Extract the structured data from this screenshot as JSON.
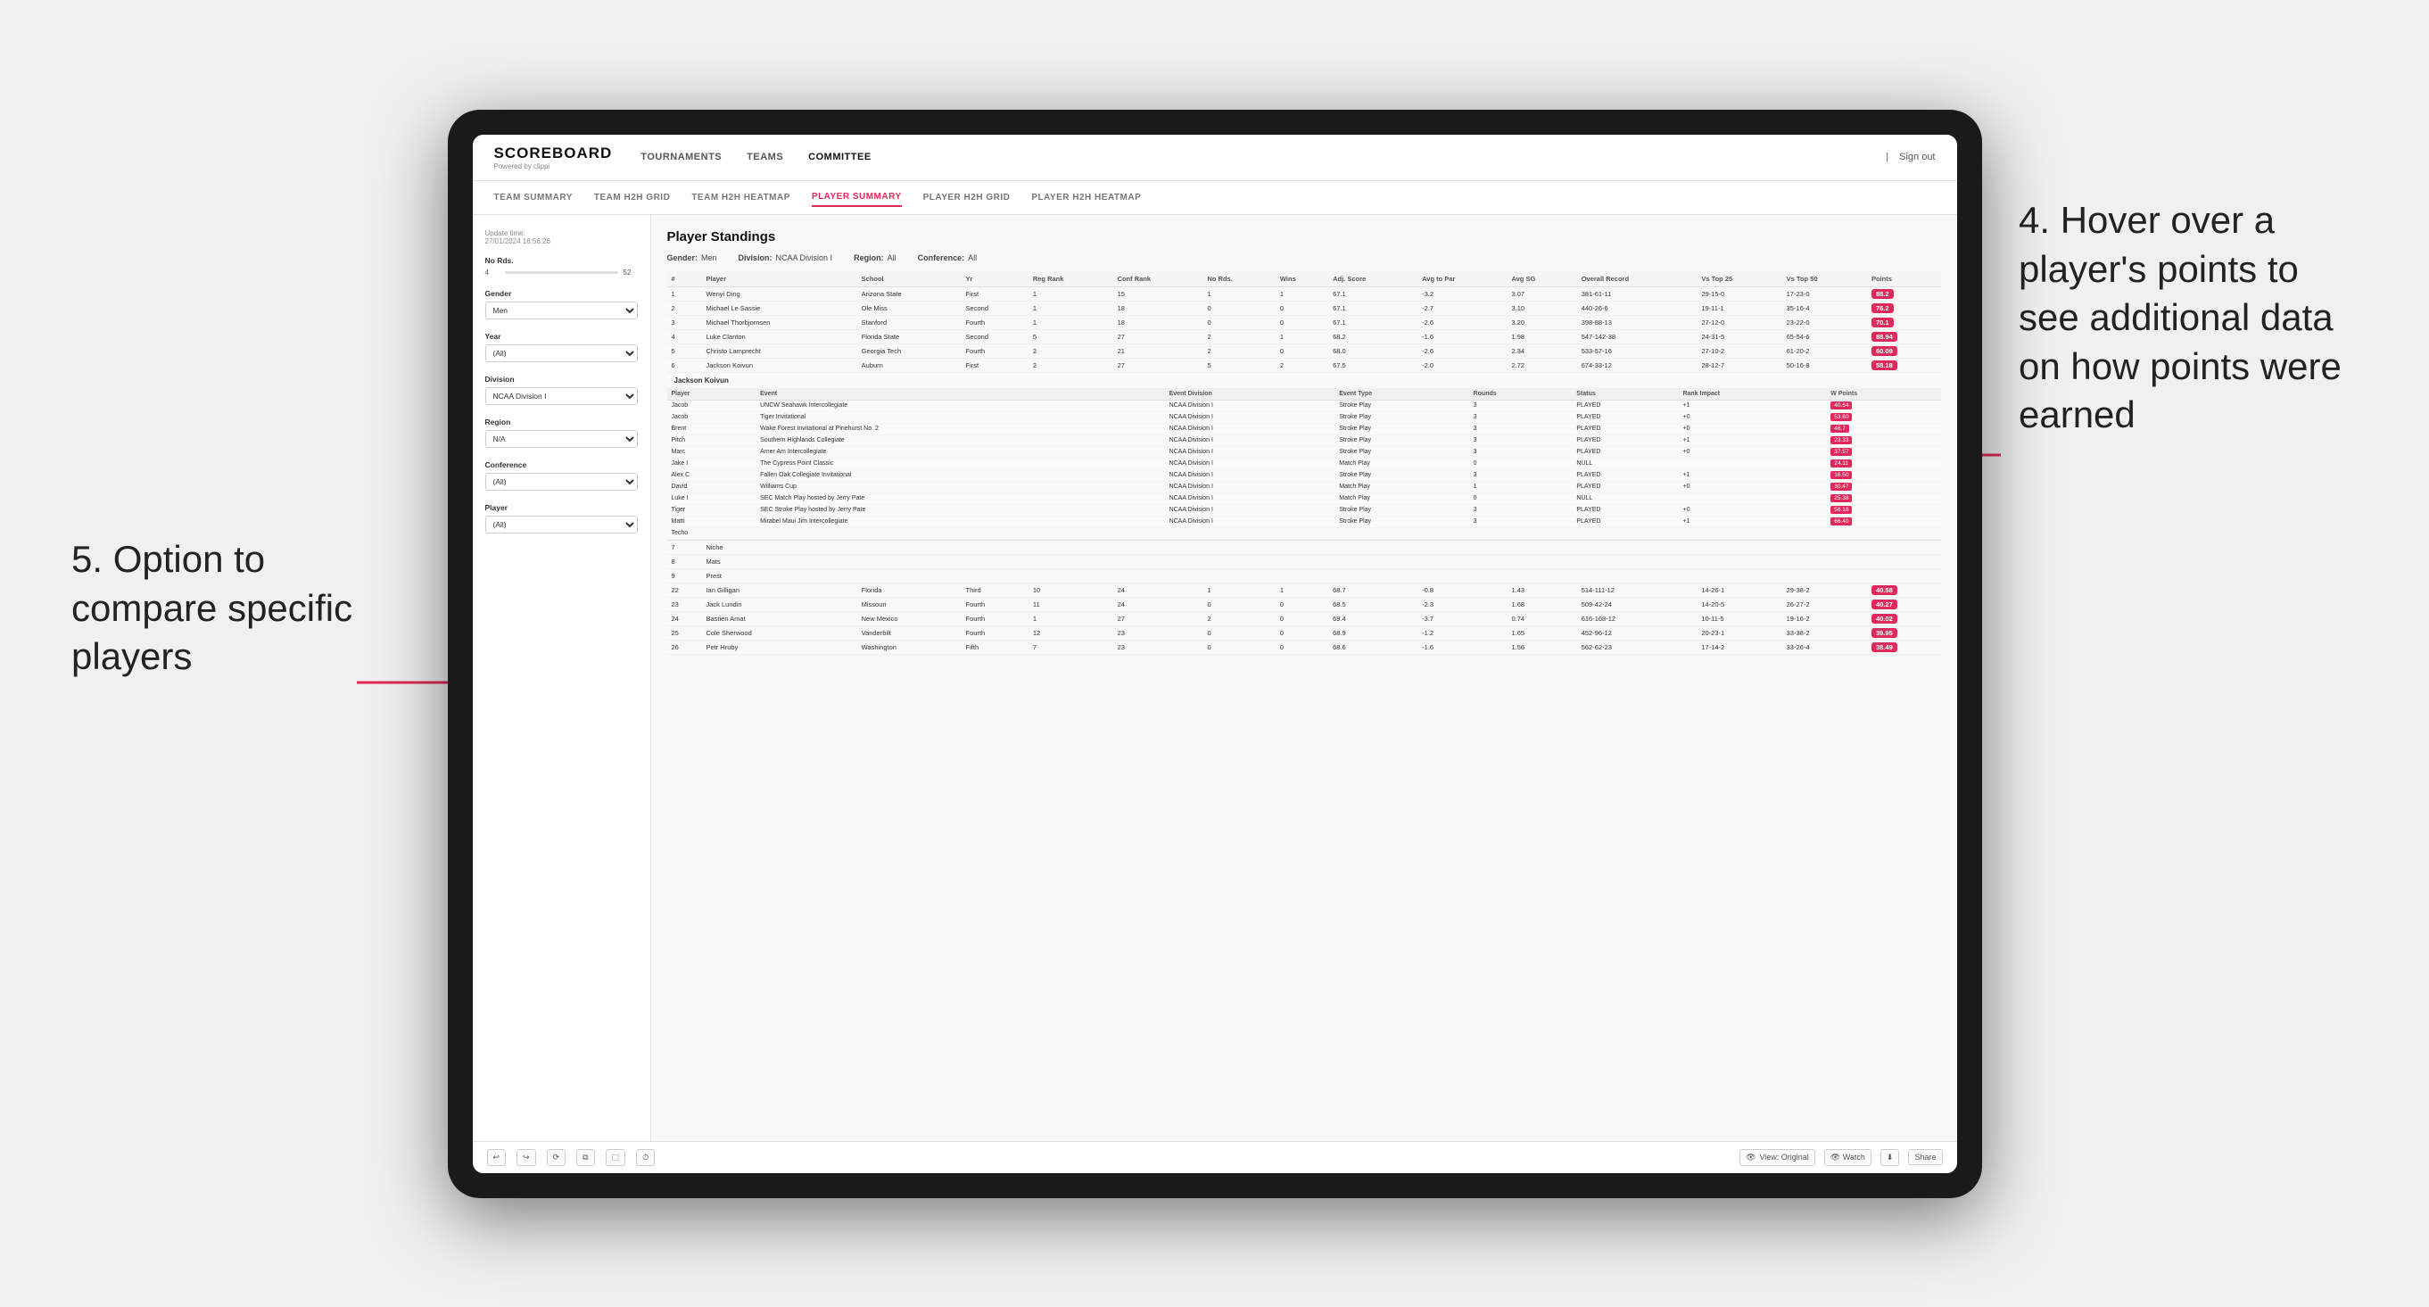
{
  "app": {
    "logo": "SCOREBOARD",
    "logo_sub": "Powered by clippi",
    "sign_out": "Sign out"
  },
  "nav": {
    "items": [
      "TOURNAMENTS",
      "TEAMS",
      "COMMITTEE"
    ],
    "active": "COMMITTEE"
  },
  "sub_nav": {
    "items": [
      "TEAM SUMMARY",
      "TEAM H2H GRID",
      "TEAM H2H HEATMAP",
      "PLAYER SUMMARY",
      "PLAYER H2H GRID",
      "PLAYER H2H HEATMAP"
    ],
    "active": "PLAYER SUMMARY"
  },
  "sidebar": {
    "update_time_label": "Update time:",
    "update_time_value": "27/01/2024 16:56:26",
    "no_rds_label": "No Rds.",
    "no_rds_min": "4",
    "no_rds_max": "52",
    "gender_label": "Gender",
    "gender_value": "Men",
    "year_label": "Year",
    "year_value": "(All)",
    "division_label": "Division",
    "division_value": "NCAA Division I",
    "region_label": "Region",
    "region_value": "N/A",
    "conference_label": "Conference",
    "conference_value": "(All)",
    "player_label": "Player",
    "player_value": "(All)"
  },
  "panel": {
    "title": "Player Standings",
    "gender_label": "Gender:",
    "gender_value": "Men",
    "division_label": "Division:",
    "division_value": "NCAA Division I",
    "region_label": "Region:",
    "region_value": "All",
    "conference_label": "Conference:",
    "conference_value": "All"
  },
  "table": {
    "headers": [
      "#",
      "Player",
      "School",
      "Yr",
      "Reg Rank",
      "Conf Rank",
      "No Rds.",
      "Wins",
      "Adj. Score",
      "Avg to Par",
      "Avg SG",
      "Overall Record",
      "Vs Top 25",
      "Vs Top 50",
      "Points"
    ],
    "rows": [
      {
        "num": "1",
        "player": "Wenyi Ding",
        "school": "Arizona State",
        "yr": "First",
        "reg_rank": "1",
        "conf_rank": "15",
        "no_rds": "1",
        "wins": "1",
        "adj_score": "67.1",
        "to_par": "-3.2",
        "avg_sg": "3.07",
        "overall": "381-61-11",
        "vs_top25": "29-15-0",
        "vs_top50": "17-23-0",
        "points": "88.2"
      },
      {
        "num": "2",
        "player": "Michael Le Sassie",
        "school": "Ole Miss",
        "yr": "Second",
        "reg_rank": "1",
        "conf_rank": "18",
        "no_rds": "0",
        "wins": "0",
        "adj_score": "67.1",
        "to_par": "-2.7",
        "avg_sg": "3.10",
        "overall": "440-26-6",
        "vs_top25": "19-11-1",
        "vs_top50": "35-16-4",
        "points": "76.2"
      },
      {
        "num": "3",
        "player": "Michael Thorbjornsen",
        "school": "Stanford",
        "yr": "Fourth",
        "reg_rank": "1",
        "conf_rank": "18",
        "no_rds": "0",
        "wins": "0",
        "adj_score": "67.1",
        "to_par": "-2.6",
        "avg_sg": "3.20",
        "overall": "398-88-13",
        "vs_top25": "27-12-0",
        "vs_top50": "23-22-0",
        "points": "70.1"
      },
      {
        "num": "4",
        "player": "Luke Clanton",
        "school": "Florida State",
        "yr": "Second",
        "reg_rank": "5",
        "conf_rank": "27",
        "no_rds": "2",
        "wins": "1",
        "adj_score": "68.2",
        "to_par": "-1.6",
        "avg_sg": "1.98",
        "overall": "547-142-38",
        "vs_top25": "24-31-5",
        "vs_top50": "65-54-6",
        "points": "88.94"
      },
      {
        "num": "5",
        "player": "Christo Lamprecht",
        "school": "Georgia Tech",
        "yr": "Fourth",
        "reg_rank": "2",
        "conf_rank": "21",
        "no_rds": "2",
        "wins": "0",
        "adj_score": "68.0",
        "to_par": "-2.6",
        "avg_sg": "2.34",
        "overall": "533-57-16",
        "vs_top25": "27-10-2",
        "vs_top50": "61-20-2",
        "points": "60.09"
      },
      {
        "num": "6",
        "player": "Jackson Koivun",
        "school": "Auburn",
        "yr": "First",
        "reg_rank": "2",
        "conf_rank": "27",
        "no_rds": "5",
        "wins": "2",
        "adj_score": "67.5",
        "to_par": "-2.0",
        "avg_sg": "2.72",
        "overall": "674-33-12",
        "vs_top25": "28-12-7",
        "vs_top50": "50-16-8",
        "points": "58.18"
      },
      {
        "num": "7",
        "player": "Niche",
        "school": "",
        "yr": "",
        "reg_rank": "",
        "conf_rank": "",
        "no_rds": "",
        "wins": "",
        "adj_score": "",
        "to_par": "",
        "avg_sg": "",
        "overall": "",
        "vs_top25": "",
        "vs_top50": "",
        "points": ""
      },
      {
        "num": "8",
        "player": "Mats",
        "school": "",
        "yr": "",
        "reg_rank": "",
        "conf_rank": "",
        "no_rds": "",
        "wins": "",
        "adj_score": "",
        "to_par": "",
        "avg_sg": "",
        "overall": "",
        "vs_top25": "",
        "vs_top50": "",
        "points": ""
      },
      {
        "num": "9",
        "player": "Prest",
        "school": "",
        "yr": "",
        "reg_rank": "",
        "conf_rank": "",
        "no_rds": "",
        "wins": "",
        "adj_score": "",
        "to_par": "",
        "avg_sg": "",
        "overall": "",
        "vs_top25": "",
        "vs_top50": "",
        "points": ""
      }
    ]
  },
  "tooltip": {
    "player_name": "Jackson Koivun",
    "headers": [
      "Player",
      "Event",
      "Event Division",
      "Event Type",
      "Rounds",
      "Status",
      "Rank Impact",
      "W Points"
    ],
    "rows": [
      {
        "player": "Jacob",
        "event": "UNCW Seahawk Intercollegiate",
        "division": "NCAA Division I",
        "type": "Stroke Play",
        "rounds": "3",
        "status": "PLAYED",
        "impact": "+1",
        "w_points": "40.64"
      },
      {
        "player": "Jacob",
        "event": "Tiger Invitational",
        "division": "NCAA Division I",
        "type": "Stroke Play",
        "rounds": "3",
        "status": "PLAYED",
        "impact": "+0",
        "w_points": "53.60"
      },
      {
        "player": "Brent",
        "event": "Wake Forest Invitational at Pinehurst No. 2",
        "division": "NCAA Division I",
        "type": "Stroke Play",
        "rounds": "3",
        "status": "PLAYED",
        "impact": "+0",
        "w_points": "46.7"
      },
      {
        "player": "Pitch",
        "event": "Southern Highlands Collegiate",
        "division": "NCAA Division I",
        "type": "Stroke Play",
        "rounds": "3",
        "status": "PLAYED",
        "impact": "+1",
        "w_points": "23.33"
      },
      {
        "player": "Marc",
        "event": "Amer Am Intercollegiate",
        "division": "NCAA Division I",
        "type": "Stroke Play",
        "rounds": "3",
        "status": "PLAYED",
        "impact": "+0",
        "w_points": "37.57"
      },
      {
        "player": "Jake I",
        "event": "The Cypress Point Classic",
        "division": "NCAA Division I",
        "type": "Match Play",
        "rounds": "0",
        "status": "NULL",
        "impact": "",
        "w_points": "24.11"
      },
      {
        "player": "Alex C",
        "event": "Fallen Oak Collegiate Invitational",
        "division": "NCAA Division I",
        "type": "Stroke Play",
        "rounds": "3",
        "status": "PLAYED",
        "impact": "+1",
        "w_points": "16.50"
      },
      {
        "player": "David",
        "event": "Williams Cup",
        "division": "NCAA Division I",
        "type": "Match Play",
        "rounds": "1",
        "status": "PLAYED",
        "impact": "+0",
        "w_points": "30.47"
      },
      {
        "player": "Luke I",
        "event": "SEC Match Play hosted by Jerry Pate",
        "division": "NCAA Division I",
        "type": "Match Play",
        "rounds": "0",
        "status": "NULL",
        "impact": "",
        "w_points": "25.38"
      },
      {
        "player": "Tiger",
        "event": "SEC Stroke Play hosted by Jerry Pate",
        "division": "NCAA Division I",
        "type": "Stroke Play",
        "rounds": "3",
        "status": "PLAYED",
        "impact": "+0",
        "w_points": "56.18"
      },
      {
        "player": "Matti",
        "event": "Mirabel Maui Jim Intercollegiate",
        "division": "NCAA Division I",
        "type": "Stroke Play",
        "rounds": "3",
        "status": "PLAYED",
        "impact": "+1",
        "w_points": "66.40"
      },
      {
        "player": "Techo",
        "event": "",
        "division": "",
        "type": "",
        "rounds": "",
        "status": "",
        "impact": "",
        "w_points": ""
      }
    ]
  },
  "extra_rows": [
    {
      "num": "22",
      "player": "Ian Gilligan",
      "school": "Florida",
      "yr": "Third",
      "reg_rank": "10",
      "conf_rank": "24",
      "no_rds": "1",
      "wins": "1",
      "adj_score": "68.7",
      "to_par": "-0.8",
      "avg_sg": "1.43",
      "overall": "514-111-12",
      "vs_top25": "14-26-1",
      "vs_top50": "29-38-2",
      "points": "40.58"
    },
    {
      "num": "23",
      "player": "Jack Lundin",
      "school": "Missouri",
      "yr": "Fourth",
      "reg_rank": "11",
      "conf_rank": "24",
      "no_rds": "0",
      "wins": "0",
      "adj_score": "68.5",
      "to_par": "-2.3",
      "avg_sg": "1.68",
      "overall": "509-42-24",
      "vs_top25": "14-20-5",
      "vs_top50": "26-27-2",
      "points": "40.27"
    },
    {
      "num": "24",
      "player": "Bastien Amat",
      "school": "New Mexico",
      "yr": "Fourth",
      "reg_rank": "1",
      "conf_rank": "27",
      "no_rds": "2",
      "wins": "0",
      "adj_score": "69.4",
      "to_par": "-3.7",
      "avg_sg": "0.74",
      "overall": "616-168-12",
      "vs_top25": "10-11-5",
      "vs_top50": "19-16-2",
      "points": "40.02"
    },
    {
      "num": "25",
      "player": "Cole Sherwood",
      "school": "Vanderbilt",
      "yr": "Fourth",
      "reg_rank": "12",
      "conf_rank": "23",
      "no_rds": "0",
      "wins": "0",
      "adj_score": "68.9",
      "to_par": "-1.2",
      "avg_sg": "1.65",
      "overall": "452-96-12",
      "vs_top25": "20-23-1",
      "vs_top50": "33-38-2",
      "points": "39.95"
    },
    {
      "num": "26",
      "player": "Petr Hruby",
      "school": "Washington",
      "yr": "Fifth",
      "reg_rank": "7",
      "conf_rank": "23",
      "no_rds": "0",
      "wins": "0",
      "adj_score": "68.6",
      "to_par": "-1.6",
      "avg_sg": "1.56",
      "overall": "562-62-23",
      "vs_top25": "17-14-2",
      "vs_top50": "33-26-4",
      "points": "38.49"
    }
  ],
  "toolbar": {
    "view_label": "View: Original",
    "watch_label": "Watch",
    "share_label": "Share"
  },
  "annotations": {
    "annotation4": "4. Hover over a player's points to see additional data on how points were earned",
    "annotation5": "5. Option to compare specific players"
  }
}
